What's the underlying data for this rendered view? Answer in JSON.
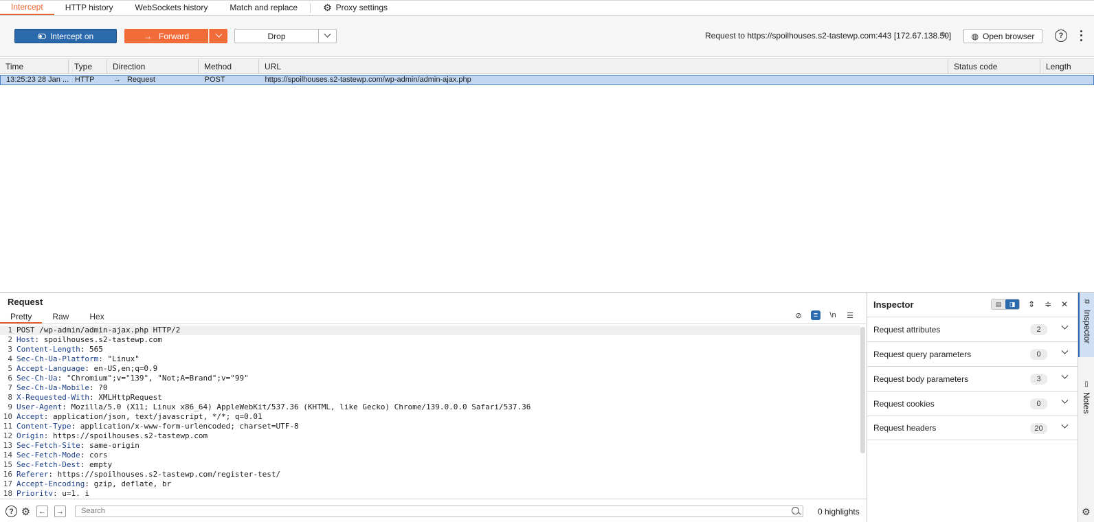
{
  "tabs": [
    {
      "label": "Intercept",
      "active": true
    },
    {
      "label": "HTTP history",
      "active": false
    },
    {
      "label": "WebSockets history",
      "active": false
    },
    {
      "label": "Match and replace",
      "active": false
    },
    {
      "label": "Proxy settings",
      "active": false,
      "icon": "gear-icon"
    }
  ],
  "toolbar": {
    "intercept_label": "Intercept on",
    "forward_label": "Forward",
    "drop_label": "Drop",
    "request_to": "Request to https://spoilhouses.s2-tastewp.com:443  [172.67.138.50]",
    "open_browser_label": "Open browser"
  },
  "table": {
    "columns": [
      "Time",
      "Type",
      "Direction",
      "Method",
      "URL",
      "Status code",
      "Length"
    ],
    "rows": [
      {
        "time": "13:25:23 28 Jan ...",
        "type": "HTTP",
        "direction": "Request",
        "method": "POST",
        "url": "https://spoilhouses.s2-tastewp.com/wp-admin/admin-ajax.php",
        "status": "",
        "length": ""
      }
    ]
  },
  "request": {
    "title": "Request",
    "tabs": [
      "Pretty",
      "Raw",
      "Hex"
    ],
    "active_tab": "Pretty",
    "lines": [
      {
        "n": "1",
        "k": "",
        "v": "POST /wp-admin/admin-ajax.php HTTP/2"
      },
      {
        "n": "2",
        "k": "Host",
        "v": ": spoilhouses.s2-tastewp.com"
      },
      {
        "n": "3",
        "k": "Content-Length",
        "v": ": 565"
      },
      {
        "n": "4",
        "k": "Sec-Ch-Ua-Platform",
        "v": ": \"Linux\""
      },
      {
        "n": "5",
        "k": "Accept-Language",
        "v": ": en-US,en;q=0.9"
      },
      {
        "n": "6",
        "k": "Sec-Ch-Ua",
        "v": ": \"Chromium\";v=\"139\", \"Not;A=Brand\";v=\"99\""
      },
      {
        "n": "7",
        "k": "Sec-Ch-Ua-Mobile",
        "v": ": ?0"
      },
      {
        "n": "8",
        "k": "X-Requested-With",
        "v": ": XMLHttpRequest"
      },
      {
        "n": "9",
        "k": "User-Agent",
        "v": ": Mozilla/5.0 (X11; Linux x86_64) AppleWebKit/537.36 (KHTML, like Gecko) Chrome/139.0.0.0 Safari/537.36"
      },
      {
        "n": "10",
        "k": "Accept",
        "v": ": application/json, text/javascript, */*; q=0.01"
      },
      {
        "n": "11",
        "k": "Content-Type",
        "v": ": application/x-www-form-urlencoded; charset=UTF-8"
      },
      {
        "n": "12",
        "k": "Origin",
        "v": ": https://spoilhouses.s2-tastewp.com"
      },
      {
        "n": "13",
        "k": "Sec-Fetch-Site",
        "v": ": same-origin"
      },
      {
        "n": "14",
        "k": "Sec-Fetch-Mode",
        "v": ": cors"
      },
      {
        "n": "15",
        "k": "Sec-Fetch-Dest",
        "v": ": empty"
      },
      {
        "n": "16",
        "k": "Referer",
        "v": ": https://spoilhouses.s2-tastewp.com/register-test/"
      },
      {
        "n": "17",
        "k": "Accept-Encoding",
        "v": ": gzip, deflate, br"
      },
      {
        "n": "18",
        "k": "Priority",
        "v": ": u=1, i"
      }
    ]
  },
  "search": {
    "placeholder": "Search",
    "highlights": "0 highlights"
  },
  "inspector": {
    "title": "Inspector",
    "items": [
      {
        "label": "Request attributes",
        "count": "2"
      },
      {
        "label": "Request query parameters",
        "count": "0"
      },
      {
        "label": "Request body parameters",
        "count": "3"
      },
      {
        "label": "Request cookies",
        "count": "0"
      },
      {
        "label": "Request headers",
        "count": "20"
      }
    ]
  },
  "side": {
    "inspector_label": "Inspector",
    "notes_label": "Notes"
  },
  "colors": {
    "accent": "#e8622f",
    "forward": "#f26c3a",
    "intercept": "#2b6aad",
    "selected_row": "#c2d8f2"
  }
}
